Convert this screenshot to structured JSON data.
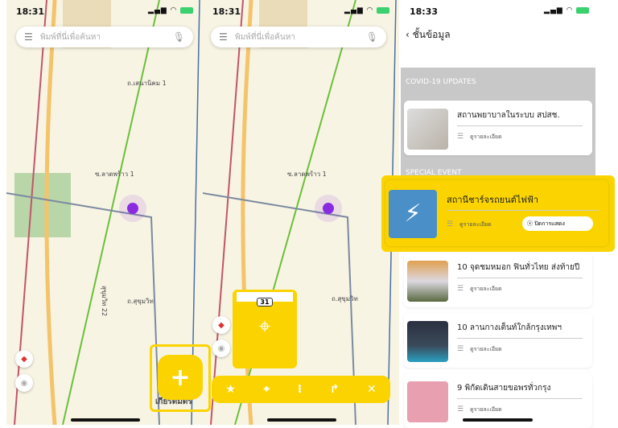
{
  "map_screens": [
    {
      "time": "18:31",
      "search_placeholder": "พิมพ์ที่นี่เพื่อค้นหา"
    },
    {
      "time": "18:31",
      "search_placeholder": "พิมพ์ที่นี่เพื่อค้นหา"
    }
  ],
  "map_labels": {
    "road_31": "31",
    "sukhumvit": "ถ.สุขุมวิท",
    "ladprao": "ซ.ลาดพร้าว 1",
    "sena": "ถ.เสนานิคม 1",
    "sukhumvit22": "สุขุมวิท 22",
    "landmark": "เกียรติมิตร"
  },
  "toolbar": {
    "icons": [
      "bookmark-star-icon",
      "map-pin-icon",
      "traffic-light-icon",
      "turn-right-icon",
      "close-icon"
    ]
  },
  "layers_screen": {
    "time": "18:33",
    "back_title": "ชั้นข้อมูล",
    "sections": [
      "COVID-19 UPDATES",
      "SPECIAL EVENT"
    ],
    "cards": [
      {
        "title": "สถานพยาบาลในระบบ สปสช.",
        "detail": "ดูรายละเอียด"
      },
      {
        "title": "สถานีชาร์จรถยนต์ไฟฟ้า",
        "detail": "ดูรายละเอียด",
        "hide": "ปิดการแสดง"
      },
      {
        "title": "10 จุดชมหมอก ฟินทั่วไทย ส่งท้ายปี",
        "detail": "ดูรายละเอียด"
      },
      {
        "title": "10 ลานกางเต็นท์ใกล้กรุงเทพฯ",
        "detail": "ดูรายละเอียด"
      },
      {
        "title": "9 พิกัดเดินสายขอพรทั่วกรุง",
        "detail": "ดูรายละเอียด"
      }
    ]
  },
  "colors": {
    "accent": "#fbd400",
    "location": "#8a2be2",
    "band": "#c8c8c8"
  }
}
